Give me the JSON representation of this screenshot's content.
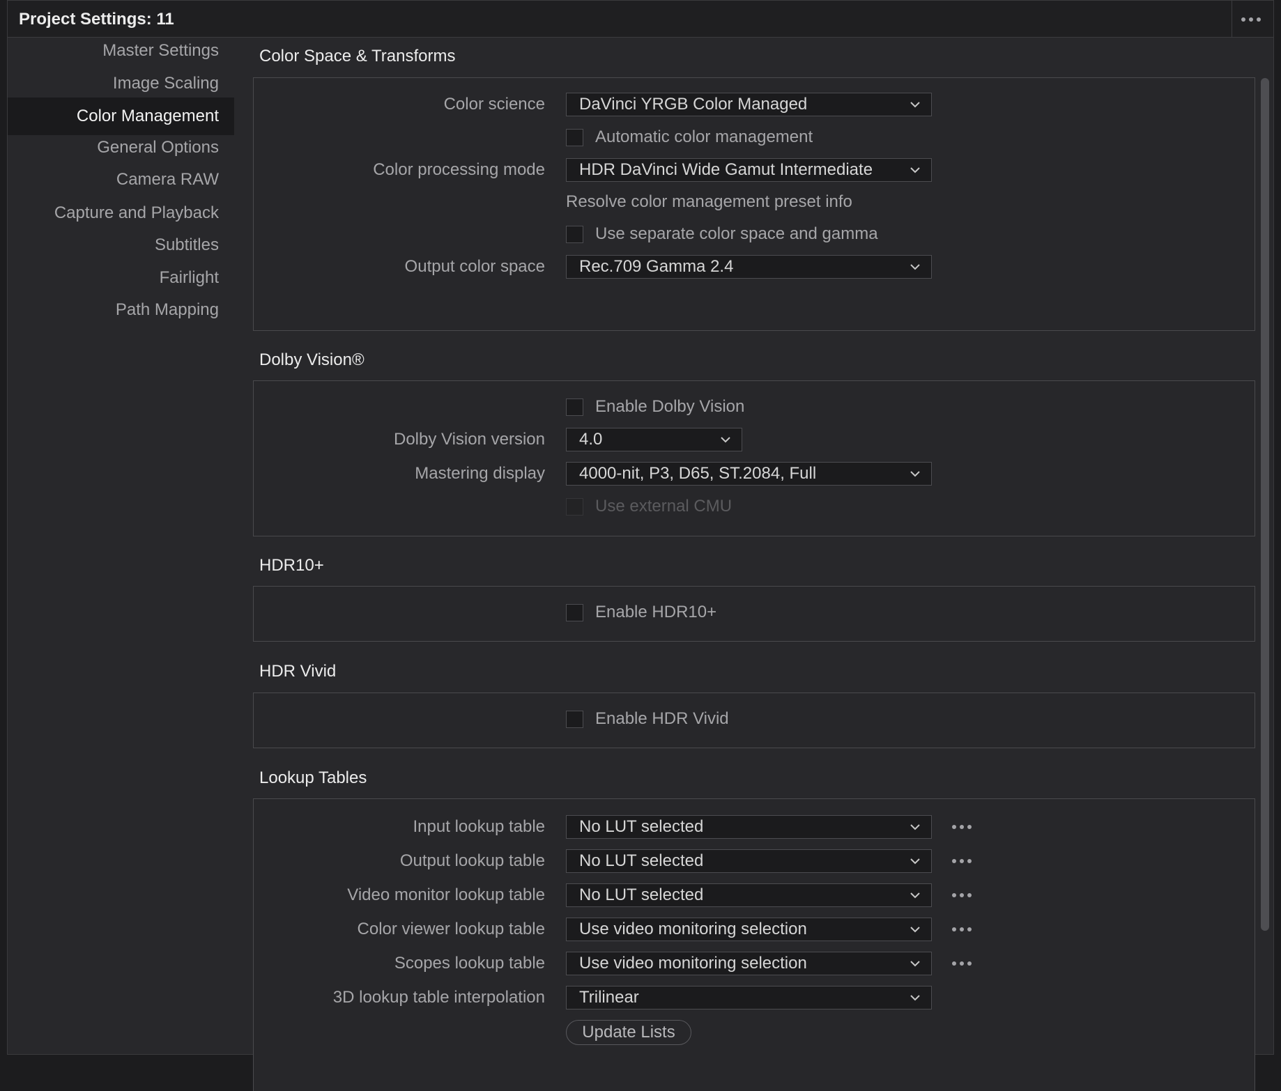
{
  "window": {
    "title": "Project Settings:  11",
    "menu_icon": "ellipsis-icon"
  },
  "sidebar": {
    "items": [
      {
        "label": "Master Settings",
        "active": false
      },
      {
        "label": "Image Scaling",
        "active": false
      },
      {
        "label": "Color Management",
        "active": true
      },
      {
        "label": "General Options",
        "active": false
      },
      {
        "label": "Camera RAW",
        "active": false
      },
      {
        "label": "Capture and Playback",
        "active": false
      },
      {
        "label": "Subtitles",
        "active": false
      },
      {
        "label": "Fairlight",
        "active": false
      },
      {
        "label": "Path Mapping",
        "active": false
      }
    ]
  },
  "color_space": {
    "title": "Color Space & Transforms",
    "color_science_label": "Color science",
    "color_science_value": "DaVinci YRGB Color Managed",
    "auto_cm_label": "Automatic color management",
    "auto_cm_checked": false,
    "processing_mode_label": "Color processing mode",
    "processing_mode_value": "HDR DaVinci Wide Gamut Intermediate",
    "preset_info": "Resolve color management preset info",
    "separate_label": "Use separate color space and gamma",
    "separate_checked": false,
    "output_space_label": "Output color space",
    "output_space_value": "Rec.709 Gamma 2.4"
  },
  "dolby": {
    "title": "Dolby Vision®",
    "enable_label": "Enable Dolby Vision",
    "enable_checked": false,
    "version_label": "Dolby Vision version",
    "version_value": "4.0",
    "mastering_label": "Mastering display",
    "mastering_value": "4000-nit, P3, D65, ST.2084, Full",
    "external_cmu_label": "Use external CMU",
    "external_cmu_enabled": false
  },
  "hdr10plus": {
    "title": "HDR10+",
    "enable_label": "Enable HDR10+",
    "enable_checked": false
  },
  "hdrvivid": {
    "title": "HDR Vivid",
    "enable_label": "Enable HDR Vivid",
    "enable_checked": false
  },
  "lookup": {
    "title": "Lookup Tables",
    "rows": [
      {
        "label": "Input lookup table",
        "value": "No LUT selected"
      },
      {
        "label": "Output lookup table",
        "value": "No LUT selected"
      },
      {
        "label": "Video monitor lookup table",
        "value": "No LUT selected"
      },
      {
        "label": "Color viewer lookup table",
        "value": "Use video monitoring selection"
      },
      {
        "label": "Scopes lookup table",
        "value": "Use video monitoring selection"
      }
    ],
    "interp_label": "3D lookup table interpolation",
    "interp_value": "Trilinear",
    "update_button": "Update Lists"
  },
  "colors": {
    "background": "#28282b",
    "panel_border": "#4a4a4d",
    "field_bg": "#1b1b1d",
    "active_bg": "#1a1a1c"
  }
}
